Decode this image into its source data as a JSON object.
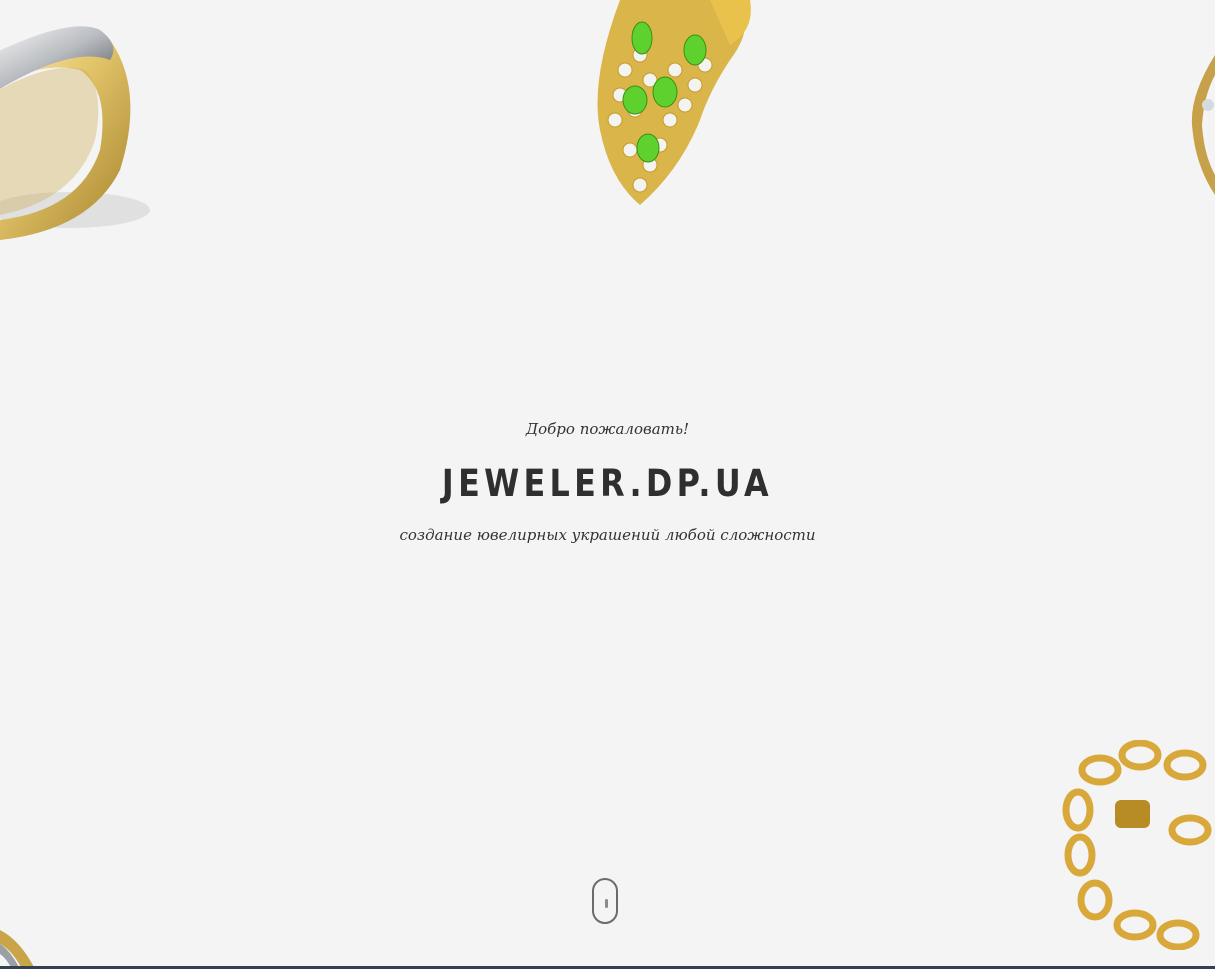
{
  "hero": {
    "welcome": "Добро пожаловать!",
    "title": "JEWELER.DP.UA",
    "tagline": "создание ювелирных украшений любой сложности"
  },
  "decorations": {
    "ring_left": "gold-silver-ring",
    "pendant": "gold-pendant-green-gems",
    "ring_right": "ring-partial",
    "bracelet": "gold-chain-bracelet",
    "ring_bottom_left": "ring-partial"
  },
  "scroll_indicator": {
    "icon": "mouse-scroll-icon"
  },
  "colors": {
    "background": "#f4f4f4",
    "text": "#333333",
    "title": "#2f2f2f",
    "gold": "#d9b54a",
    "gem_green": "#5fd12e"
  }
}
